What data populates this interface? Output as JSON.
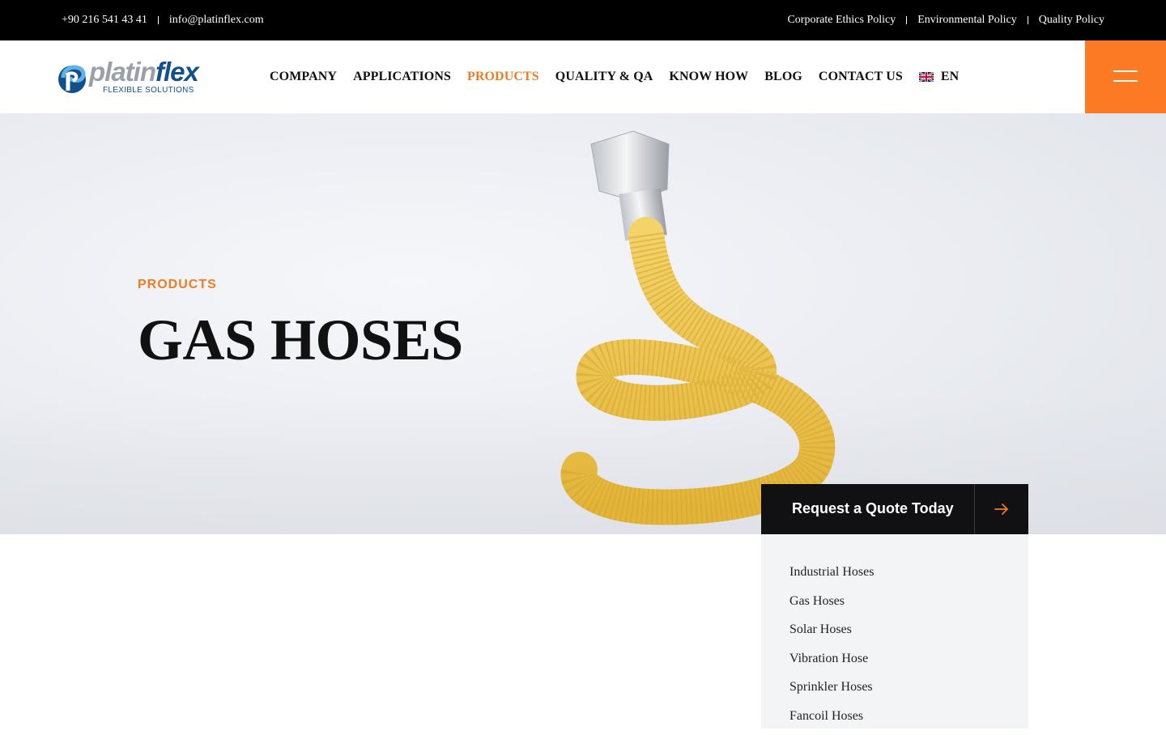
{
  "topbar": {
    "phone": "+90 216 541 43 41",
    "email": "info@platinflex.com",
    "links": [
      "Corporate Ethics Policy",
      "Environmental Policy",
      "Quality Policy"
    ]
  },
  "brand": {
    "name_part1": "platin",
    "name_part2": "flex",
    "tagline": "FLEXIBLE SOLUTIONS"
  },
  "nav": {
    "items": [
      "COMPANY",
      "APPLICATIONS",
      "PRODUCTS",
      "QUALITY & QA",
      "KNOW HOW",
      "BLOG",
      "CONTACT US"
    ],
    "active": "PRODUCTS",
    "language": "EN",
    "language_flag": "uk-flag-icon"
  },
  "hero": {
    "eyebrow": "PRODUCTS",
    "title": "GAS HOSES"
  },
  "quote": {
    "label": "Request a Quote Today",
    "icon": "arrow-right-icon"
  },
  "sidebar": {
    "items": [
      "Industrial Hoses",
      "Gas Hoses",
      "Solar Hoses",
      "Vibration Hose",
      "Sprinkler Hoses",
      "Fancoil Hoses"
    ]
  },
  "colors": {
    "accent": "#f07b22",
    "menu_button": "#fc7a23",
    "topbar": "#000000",
    "brand_blue": "#11508a"
  }
}
